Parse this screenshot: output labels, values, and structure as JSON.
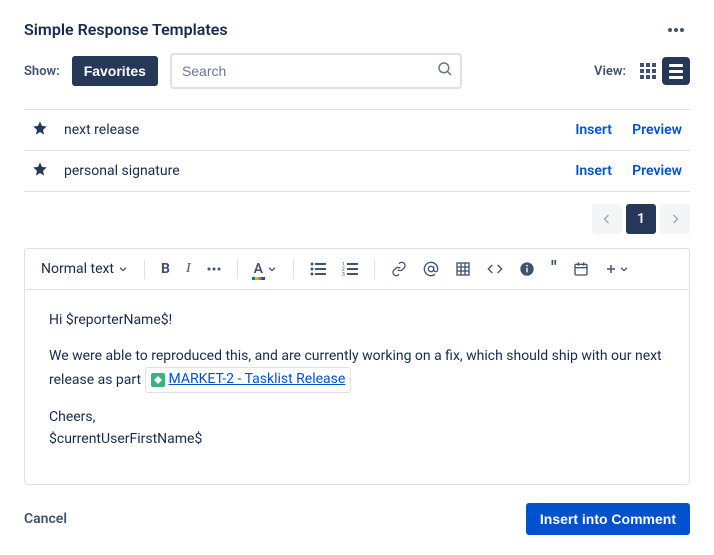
{
  "title": "Simple Response Templates",
  "show_label": "Show:",
  "favorites_label": "Favorites",
  "search_placeholder": "Search",
  "view_label": "View:",
  "templates": [
    {
      "name": "next release",
      "insert": "Insert",
      "preview": "Preview"
    },
    {
      "name": "personal signature",
      "insert": "Insert",
      "preview": "Preview"
    }
  ],
  "pager": {
    "current": "1"
  },
  "toolbar": {
    "text_style": "Normal text"
  },
  "editor": {
    "greeting": "Hi $reporterName$!",
    "body_pre": "We were able to reproduced this, and are currently working on a fix, which should ship with our next release as part ",
    "smartlink": "MARKET-2 - Tasklist Release",
    "signoff": "Cheers,",
    "signature": "$currentUserFirstName$"
  },
  "footer": {
    "cancel": "Cancel",
    "primary": "Insert into Comment"
  }
}
